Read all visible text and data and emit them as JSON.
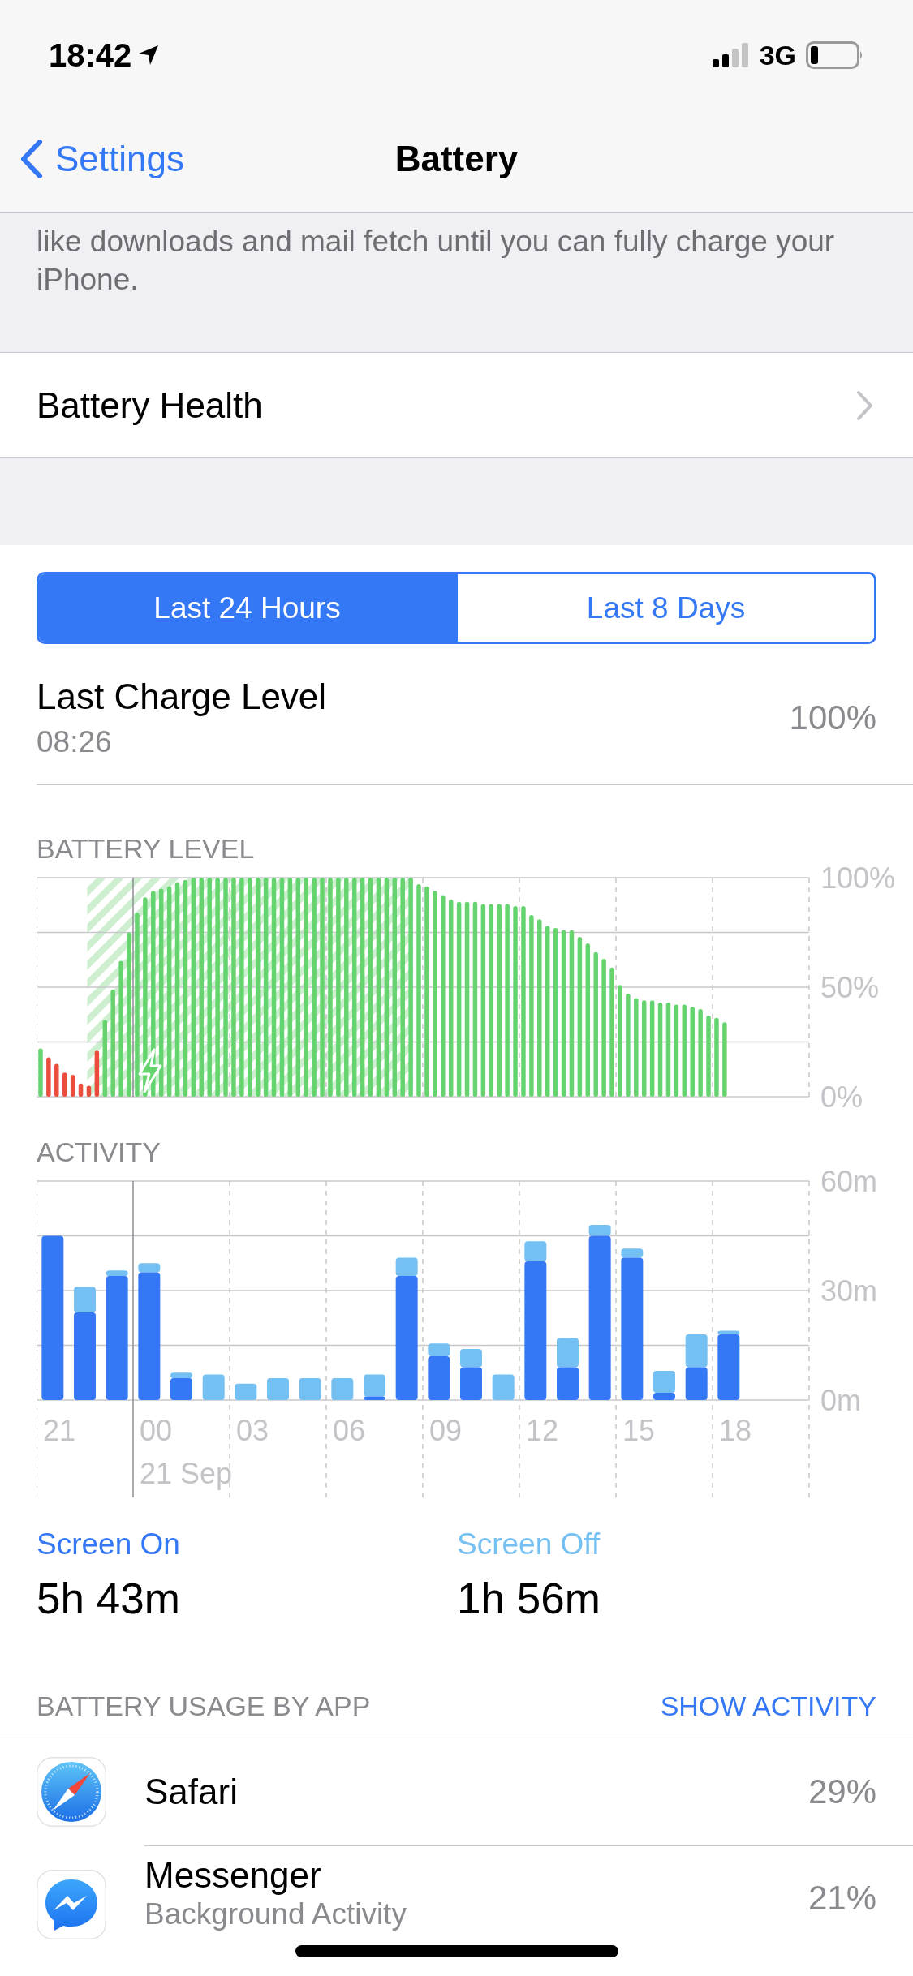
{
  "status_bar": {
    "time": "18:42",
    "network": "3G"
  },
  "nav": {
    "back": "Settings",
    "title": "Battery"
  },
  "footnote": "like downloads and mail fetch until you can fully charge your iPhone.",
  "battery_health": {
    "label": "Battery Health"
  },
  "tabs": [
    {
      "label": "Last 24 Hours",
      "selected": true
    },
    {
      "label": "Last 8 Days",
      "selected": false
    }
  ],
  "last_charge": {
    "label": "Last Charge Level",
    "time": "08:26",
    "value": "100%"
  },
  "battery_level": {
    "chart_data": {
      "type": "bar",
      "title": "BATTERY LEVEL",
      "ylim": [
        0,
        100
      ],
      "yticks": [
        {
          "value": 0,
          "label": "0%"
        },
        {
          "value": 50,
          "label": "50%"
        },
        {
          "value": 100,
          "label": "100%"
        }
      ],
      "series": [
        {
          "color": "#65d46e",
          "values": [
            22,
            null,
            null,
            null,
            null,
            null,
            null,
            null,
            35,
            49,
            62,
            75,
            84,
            91,
            94,
            95,
            96,
            98,
            99,
            100,
            100,
            100,
            100,
            100,
            100,
            100,
            100,
            100,
            100,
            100,
            100,
            100,
            100,
            100,
            100,
            100,
            100,
            100,
            100,
            100,
            100,
            100,
            100,
            100,
            100,
            100,
            100,
            97,
            96,
            94,
            92,
            90,
            89,
            89,
            89,
            88,
            88,
            88,
            88,
            87,
            87,
            83,
            81,
            78,
            77,
            76,
            76,
            73,
            70,
            66,
            63,
            59,
            51,
            47,
            45,
            44,
            44,
            43,
            43,
            42,
            42,
            41,
            40,
            37,
            36,
            34,
            null,
            null,
            null,
            null,
            null,
            null,
            null,
            null,
            null,
            null
          ]
        },
        {
          "color": "#eb4d3d",
          "values": [
            null,
            18,
            15,
            11,
            10,
            6,
            5,
            21,
            null,
            null,
            null,
            null,
            null,
            null,
            null,
            null,
            null,
            null,
            null,
            null,
            null,
            null,
            null,
            null,
            null,
            null,
            null,
            null,
            null,
            null,
            null,
            null,
            null,
            null,
            null,
            null,
            null,
            null,
            null,
            null,
            null,
            null,
            null,
            null,
            null,
            null,
            null,
            null,
            null,
            null,
            null,
            null,
            null,
            null,
            null,
            null,
            null,
            null,
            null,
            null,
            null,
            null,
            null,
            null,
            null,
            null,
            null,
            null,
            null,
            null,
            null,
            null,
            null,
            null,
            null,
            null,
            null,
            null,
            null,
            null,
            null,
            null,
            null,
            null,
            null,
            null,
            null,
            null,
            null,
            null,
            null,
            null,
            null,
            null,
            null,
            null
          ]
        }
      ]
    }
  },
  "activity": {
    "chart_data": {
      "type": "bar",
      "title": "ACTIVITY",
      "stacked": true,
      "categories": [
        "21",
        null,
        null,
        "00",
        null,
        null,
        "03",
        null,
        null,
        "06",
        null,
        null,
        "09",
        null,
        null,
        "12",
        null,
        null,
        "15",
        null,
        null,
        "18",
        null,
        null
      ],
      "ylim": [
        0,
        60
      ],
      "yticks": [
        {
          "value": 0,
          "label": "0m"
        },
        {
          "value": 30,
          "label": "30m"
        },
        {
          "value": 60,
          "label": "60m"
        }
      ],
      "series": [
        {
          "name": "Screen On",
          "color": "#3478f6",
          "values": [
            45,
            24,
            34,
            35,
            6,
            0,
            0,
            0,
            0,
            0,
            1,
            34,
            12,
            9,
            0,
            38,
            9,
            45,
            39,
            2,
            9,
            18,
            null,
            null
          ]
        },
        {
          "name": "Screen Off",
          "color": "#75c0f2",
          "values": [
            0,
            7,
            1.5,
            2.5,
            1.5,
            7,
            4.5,
            6,
            6,
            6,
            6,
            5,
            3.5,
            5,
            7,
            5.5,
            8,
            3,
            2.5,
            6,
            9,
            1,
            null,
            null
          ]
        }
      ]
    },
    "date_label": "21 Sep"
  },
  "summary": [
    {
      "value": "5h 43m"
    },
    {
      "value": "1h 56m"
    }
  ],
  "usage": {
    "header": "BATTERY USAGE BY APP",
    "action": "SHOW ACTIVITY",
    "apps": [
      {
        "name": "Safari",
        "value": "29%"
      },
      {
        "name": "Messenger",
        "subtitle": "Background Activity",
        "value": "21%"
      }
    ]
  }
}
